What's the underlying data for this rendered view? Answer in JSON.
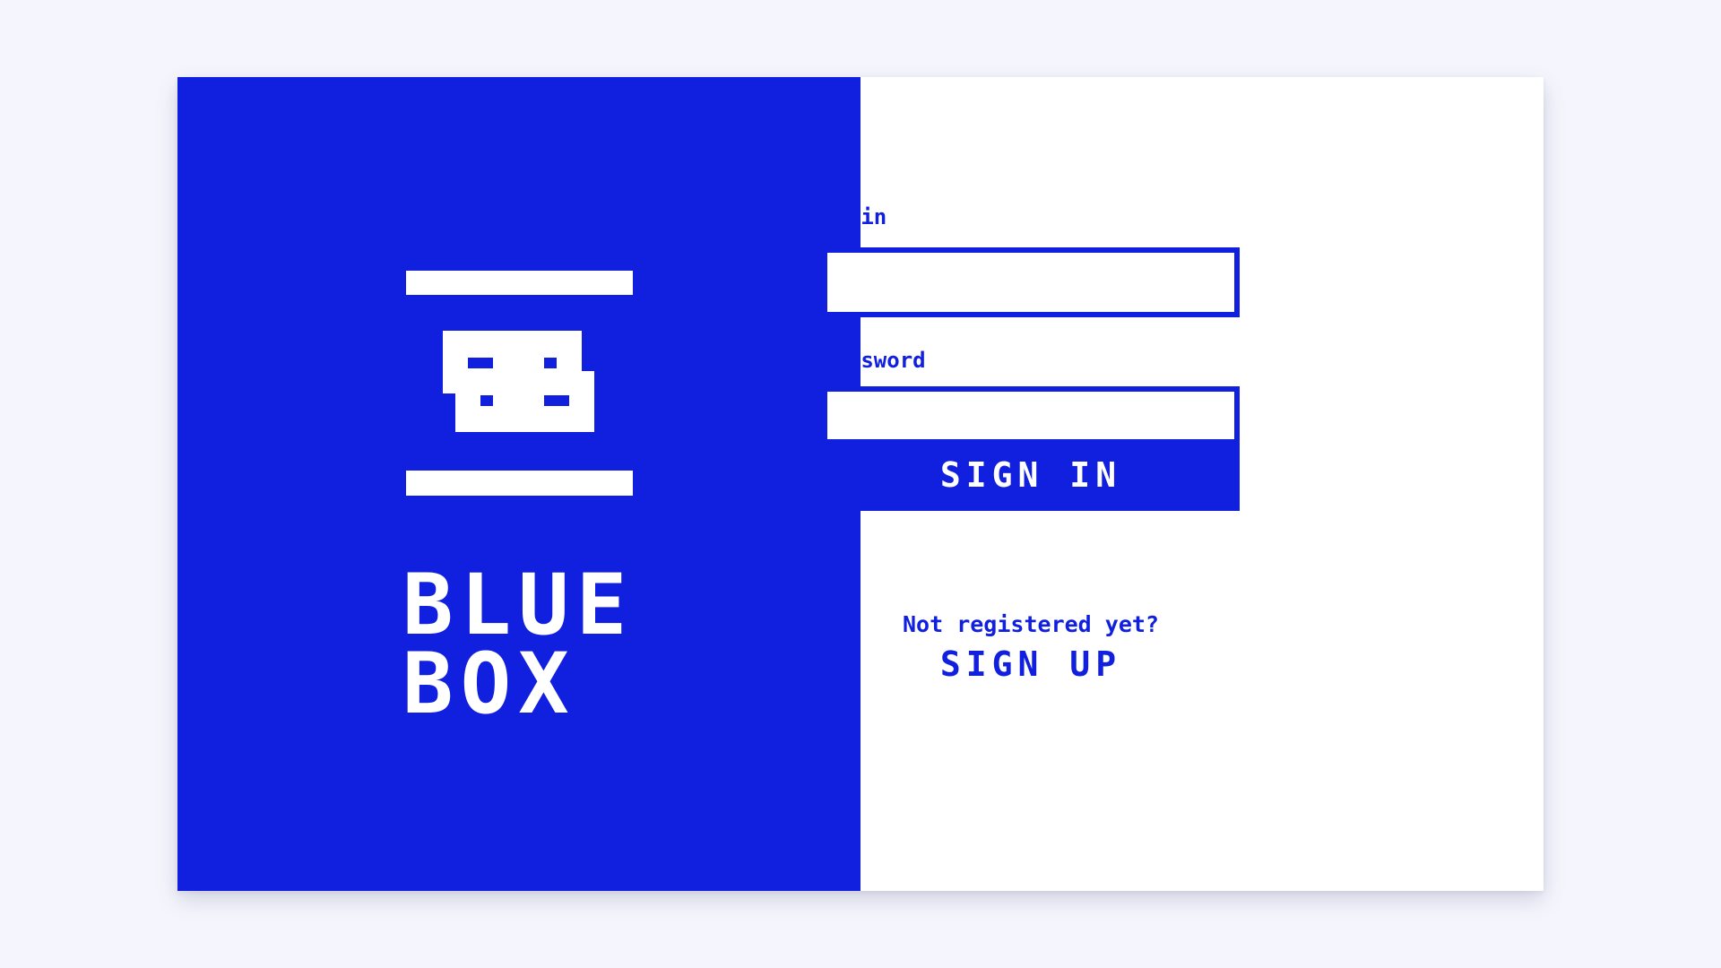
{
  "brand": {
    "name_line1": "BLUE",
    "name_line2": "BOX",
    "color": "#1120df",
    "logo_icon": "box-robot-icon"
  },
  "form": {
    "login_label": "Login",
    "login_value": "",
    "password_label": "Password",
    "password_value": "",
    "signin_label": "SIGN IN",
    "register_prompt": "Not registered yet?",
    "signup_label": "SIGN UP"
  },
  "colors": {
    "accent": "#1120df",
    "background": "#f5f6fd",
    "panel": "#ffffff"
  }
}
